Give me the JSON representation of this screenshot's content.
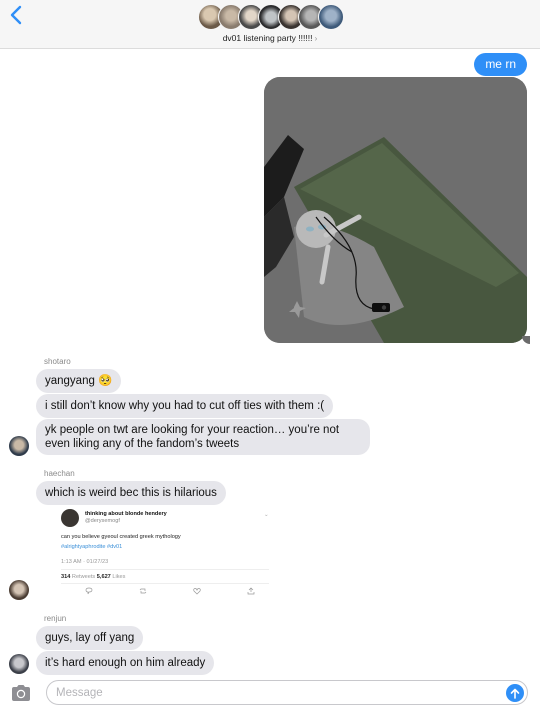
{
  "header": {
    "group_name": "dv01 listening party !!!!!!",
    "chevron": "›",
    "avatar_count": 7
  },
  "messages": {
    "sent_text": "me rn",
    "shotaro": {
      "name": "shotaro",
      "msg1": "yangyang 🥺",
      "msg2": "i still don’t know why you had to cut off ties with them :(",
      "msg3": "yk people on twt are looking for your reaction… you’re not even liking any of the fandom’s tweets"
    },
    "haechan": {
      "name": "haechan",
      "msg1": "which is weird bec this is hilarious"
    },
    "renjun": {
      "name": "renjun",
      "msg1": "guys, lay off yang",
      "msg2": "it’s hard enough on him already"
    }
  },
  "tweet": {
    "name": "thinking about blonde hendery",
    "handle": "@derysemogf",
    "more": "⌄",
    "text": "can you believe gyeoul created greek mythology",
    "hashtags": "#alrightyaphrodite #dv01",
    "date": "1:13 AM · 01/27/23",
    "retweets_count": "314",
    "retweets_label": "Retweets",
    "likes_count": "5,627",
    "likes_label": "Likes"
  },
  "input": {
    "placeholder": "Message",
    "value": ""
  },
  "icons": {
    "back": "chevron-left-icon",
    "camera": "camera-icon",
    "send": "arrow-up-icon"
  },
  "colors": {
    "accent": "#2f8ff7",
    "received_bubble": "#e6e6eb"
  }
}
